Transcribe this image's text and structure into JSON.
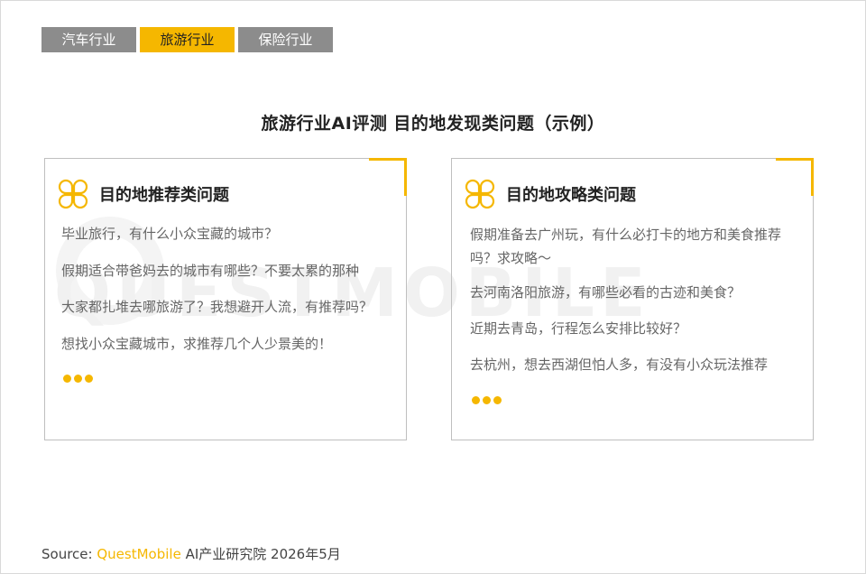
{
  "tabs": [
    {
      "label": "汽车行业",
      "active": false
    },
    {
      "label": "旅游行业",
      "active": true
    },
    {
      "label": "保险行业",
      "active": false
    }
  ],
  "title": "旅游行业AI评测  目的地发现类问题（示例）",
  "watermark": "QUESTMOBILE",
  "left_card": {
    "title": "目的地推荐类问题",
    "icon": "clover-icon",
    "questions": [
      "毕业旅行，有什么小众宝藏的城市？",
      "假期适合带爸妈去的城市有哪些？不要太累的那种",
      "大家都扎堆去哪旅游了？我想避开人流，有推荐吗？",
      "想找小众宝藏城市，求推荐几个人少景美的！"
    ]
  },
  "right_card": {
    "title": "目的地攻略类问题",
    "icon": "clover-icon",
    "questions": [
      "假期准备去广州玩，有什么必打卡的地方和美食推荐吗？求攻略～",
      "去河南洛阳旅游，有哪些必看的古迹和美食？",
      "近期去青岛，行程怎么安排比较好？",
      "去杭州，想去西湖但怕人多，有没有小众玩法推荐"
    ]
  },
  "source": {
    "prefix": "Source:",
    "brand": "QuestMobile",
    "suffix": "AI产业研究院 2026年5月"
  },
  "colors": {
    "accent": "#f5b700",
    "tab_inactive": "#8c8c8c",
    "border": "#bfbfbf"
  }
}
